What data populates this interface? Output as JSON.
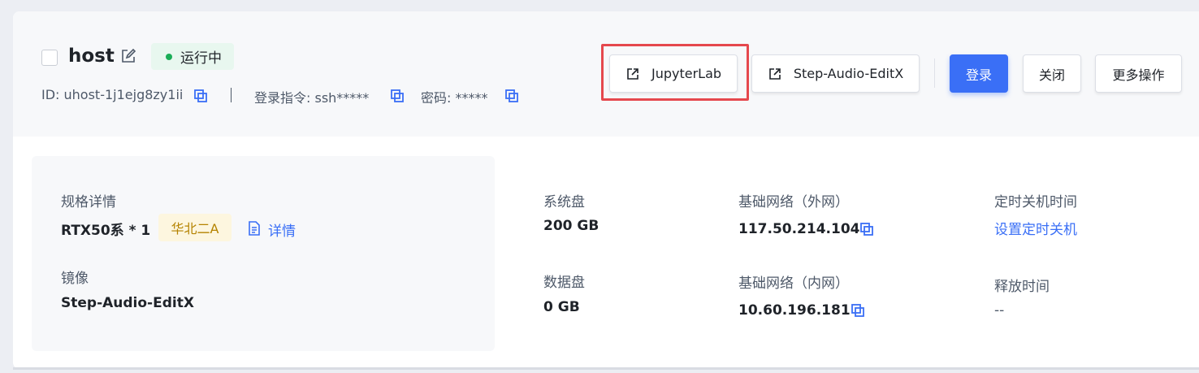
{
  "header": {
    "host_name": "host",
    "status": "运行中",
    "id_text": "ID: uhost-1j1ejg8zy1ii",
    "login_cmd_text": "登录指令: ssh*****",
    "password_text": "密码: *****"
  },
  "actions": {
    "jupyterlab": "JupyterLab",
    "app": "Step-Audio-EditX",
    "login": "登录",
    "shutdown": "关闭",
    "more": "更多操作"
  },
  "spec": {
    "label": "规格详情",
    "gpu": "RTX50系 * 1",
    "region": "华北二A",
    "details_link": "详情",
    "image_label": "镜像",
    "image_value": "Step-Audio-EditX"
  },
  "disks": {
    "system_label": "系统盘",
    "system_value": "200 GB",
    "data_label": "数据盘",
    "data_value": "0 GB"
  },
  "network": {
    "public_label": "基础网络（外网）",
    "public_ip": "117.50.214.104",
    "private_label": "基础网络（内网）",
    "private_ip": "10.60.196.181"
  },
  "schedule": {
    "shutdown_label": "定时关机时间",
    "shutdown_link": "设置定时关机",
    "release_label": "释放时间",
    "release_value": "--"
  },
  "colors": {
    "accent": "#3a6ff6",
    "status_green": "#1aad57",
    "highlight_red": "#e5484d",
    "region_tag_text": "#b58300"
  },
  "icons": [
    "checkbox",
    "edit-icon",
    "copy-icon",
    "external-link-icon",
    "document-icon"
  ]
}
